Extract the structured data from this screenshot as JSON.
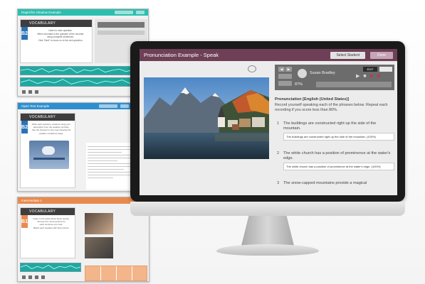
{
  "colors": {
    "titlebar": "#6e3f57",
    "win1_bar": "#2bbfb0",
    "win2_bar": "#2e8fd0",
    "win3_bar": "#e88a4e",
    "level_b2": "#2a73b8",
    "level_b1": "#e88a4e"
  },
  "bg_windows": [
    {
      "title": "Rapid-fire Shadow Example",
      "card_title": "VOCABULARY",
      "level": "B2",
      "text": [
        "Listen to each question.",
        "When recorded to the question of the recorder",
        "using complete sentences.",
        "Click \"Next\" to move on to the next question."
      ]
    },
    {
      "title": "Open Text Example",
      "card_title": "VOCABULARY",
      "level": "B2",
      "text": [
        "Write each question, answers using your",
        "description from the weather symbols.",
        "Use the forecast on the map showing the",
        "weather conditions today."
      ]
    },
    {
      "title": "Intermediate 1",
      "card_title": "VOCABULARY",
      "level": "B1",
      "text": [
        "Listen to the audio about these people.",
        "Choose the correct picture for",
        "each sentence you hear.",
        "Match each speaker with their picture."
      ]
    }
  ],
  "app": {
    "title": "Pronunciation Example - Speak",
    "select_student": "Select Student",
    "done": "Done",
    "recorder": {
      "name": "Susan Bradley",
      "percent": "87%",
      "edit_label": "EDIT",
      "icons": [
        "play-icon",
        "stop-icon",
        "record-icon",
        "delete-icon"
      ]
    },
    "heading": "Pronunciation [English (United States)]",
    "instructions": "Record yourself speaking each of the phrases below. Repeat each recording if you score less than 80%.",
    "items": [
      {
        "num": "1",
        "text": "The buildings are constructed right up the side of the mountain.",
        "answer": "The buildings are constructed right up the side of the mountain. (100%)"
      },
      {
        "num": "2",
        "text": "The white church has a position of prominence at the water's edge.",
        "answer": "The white church has a position of prominence at the water's edge. (100%)"
      },
      {
        "num": "3",
        "text": "The snow-capped mountains provide a magical",
        "answer": ""
      }
    ]
  }
}
